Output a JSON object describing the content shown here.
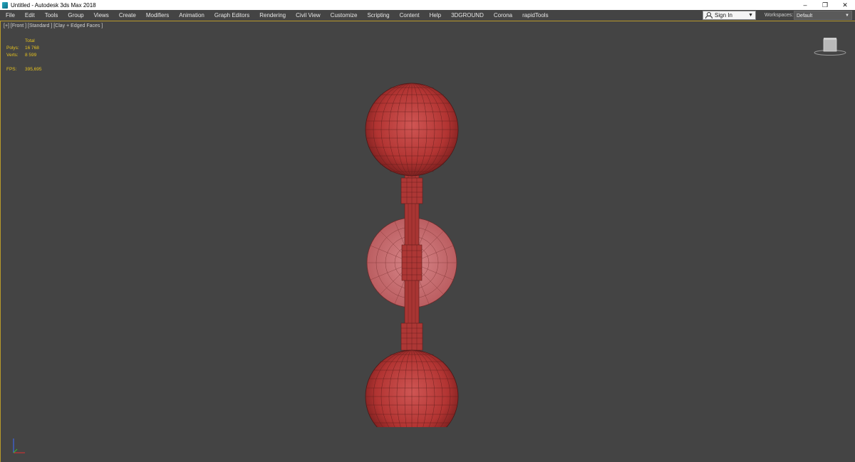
{
  "window": {
    "title": "Untitled - Autodesk 3ds Max 2018",
    "minimize": "–",
    "maximize": "❐",
    "close": "✕"
  },
  "menu": {
    "items": [
      "File",
      "Edit",
      "Tools",
      "Group",
      "Views",
      "Create",
      "Modifiers",
      "Animation",
      "Graph Editors",
      "Rendering",
      "Civil View",
      "Customize",
      "Scripting",
      "Content",
      "Help",
      "3DGROUND",
      "Corona",
      "rapidTools"
    ]
  },
  "account": {
    "signin_label": "Sign In",
    "workspaces_label": "Workspaces:",
    "workspace_value": "Default"
  },
  "viewport": {
    "label": "[+] [Front ] [Standard ] [Clay + Edged Faces ]",
    "stats": {
      "header": "Total",
      "polys_label": "Polys:",
      "polys_value": "16 768",
      "verts_label": "Verts:",
      "verts_value": "8 599",
      "fps_label": "FPS:",
      "fps_value": "395,695"
    },
    "model_color": "#b83a38",
    "disc_color": "#c56466"
  },
  "colors": {
    "ui_bg": "#444444",
    "accent": "#b89a2a",
    "stats_text": "#e6c21e"
  }
}
